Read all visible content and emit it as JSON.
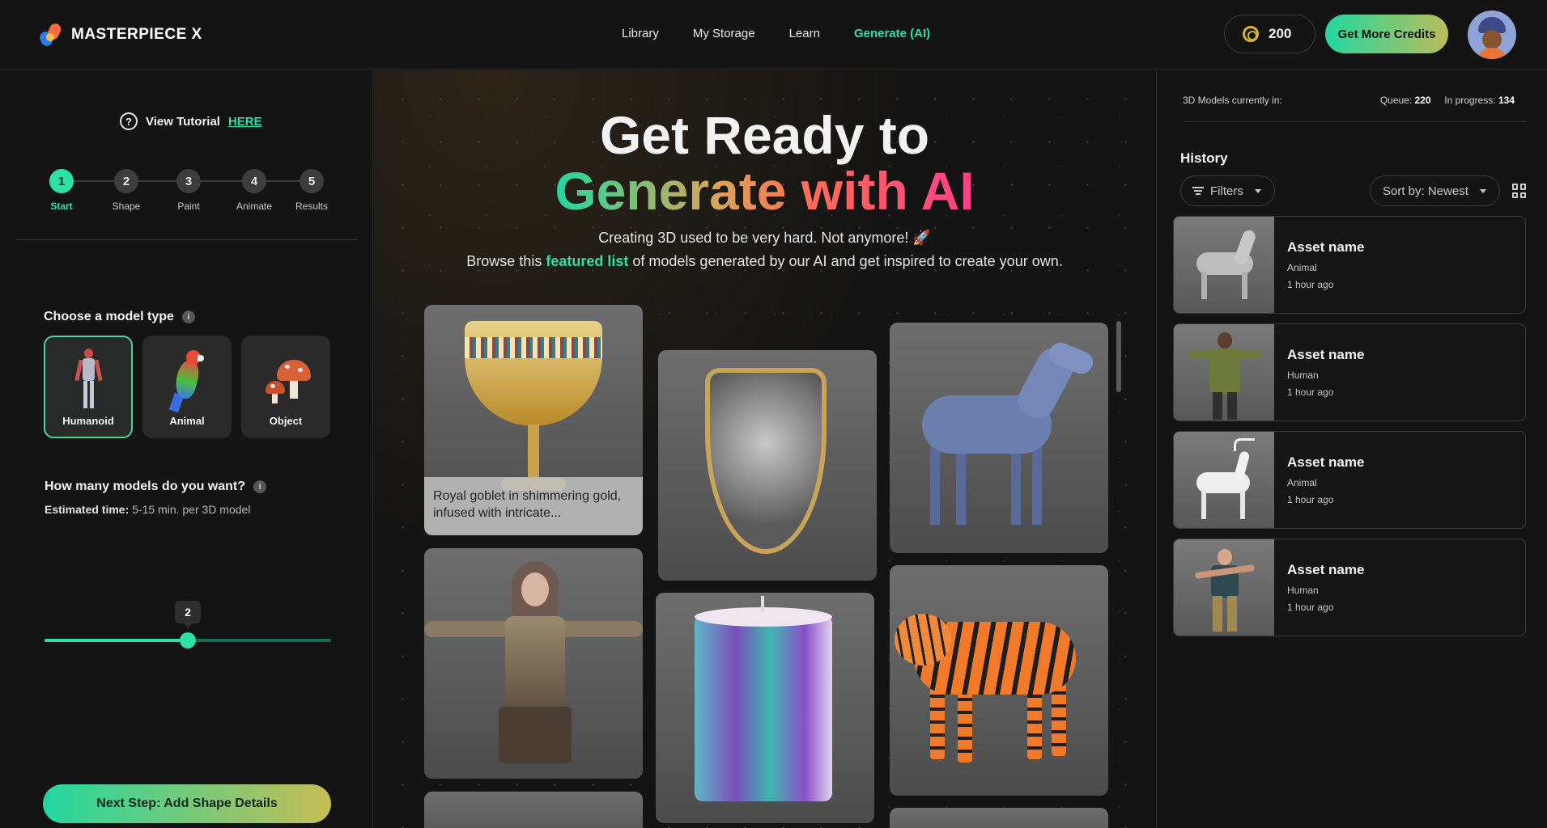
{
  "header": {
    "logo_text": "MASTERPIECE X",
    "nav": [
      {
        "label": "Library",
        "active": false
      },
      {
        "label": "My Storage",
        "active": false
      },
      {
        "label": "Learn",
        "active": false
      },
      {
        "label": "Generate (AI)",
        "active": true
      }
    ],
    "credits": "200",
    "get_credits_label": "Get More Credits"
  },
  "left": {
    "tutorial_text": "View Tutorial",
    "tutorial_link": "HERE",
    "steps": [
      {
        "num": "1",
        "label": "Start",
        "active": true
      },
      {
        "num": "2",
        "label": "Shape",
        "active": false
      },
      {
        "num": "3",
        "label": "Paint",
        "active": false
      },
      {
        "num": "4",
        "label": "Animate",
        "active": false
      },
      {
        "num": "5",
        "label": "Results",
        "active": false
      }
    ],
    "model_type_title": "Choose a model type",
    "model_types": [
      {
        "label": "Humanoid",
        "selected": true
      },
      {
        "label": "Animal",
        "selected": false
      },
      {
        "label": "Object",
        "selected": false
      }
    ],
    "count_title": "How many models do you want?",
    "estimate_label": "Estimated time:",
    "estimate_value": "5-15 min. per 3D model",
    "slider": {
      "value": 2,
      "min": 0,
      "max": 4,
      "display": "2"
    },
    "next_button": "Next Step: Add Shape Details"
  },
  "hero": {
    "line1": "Get Ready to",
    "line2": "Generate with AI",
    "sub1": "Creating 3D used to be very hard. Not anymore! 🚀",
    "sub2_pre": "Browse this",
    "sub2_link": "featured list",
    "sub2_post": "of models generated by our AI and get inspired to create your own.",
    "cards": [
      {
        "name": "goblet",
        "caption": "Royal goblet in shimmering gold, infused with intricate..."
      },
      {
        "name": "shield",
        "caption": ""
      },
      {
        "name": "horse",
        "caption": ""
      },
      {
        "name": "warrior",
        "caption": ""
      },
      {
        "name": "candle",
        "caption": ""
      },
      {
        "name": "tiger",
        "caption": ""
      }
    ]
  },
  "right": {
    "queue_label": "3D Models currently in:",
    "queue_text": "Queue:",
    "queue_value": "220",
    "progress_text": "In progress:",
    "progress_value": "134",
    "history_title": "History",
    "filters_label": "Filters",
    "sort_label": "Sort by: Newest",
    "history": [
      {
        "name": "Asset name",
        "type": "Animal",
        "time": "1 hour ago"
      },
      {
        "name": "Asset name",
        "type": "Human",
        "time": "1 hour ago"
      },
      {
        "name": "Asset name",
        "type": "Animal",
        "time": "1 hour ago"
      },
      {
        "name": "Asset name",
        "type": "Human",
        "time": "1 hour ago"
      }
    ]
  },
  "colors": {
    "accent": "#2ee0a6",
    "background": "#141414",
    "gradient_end": "#c5bd55"
  }
}
